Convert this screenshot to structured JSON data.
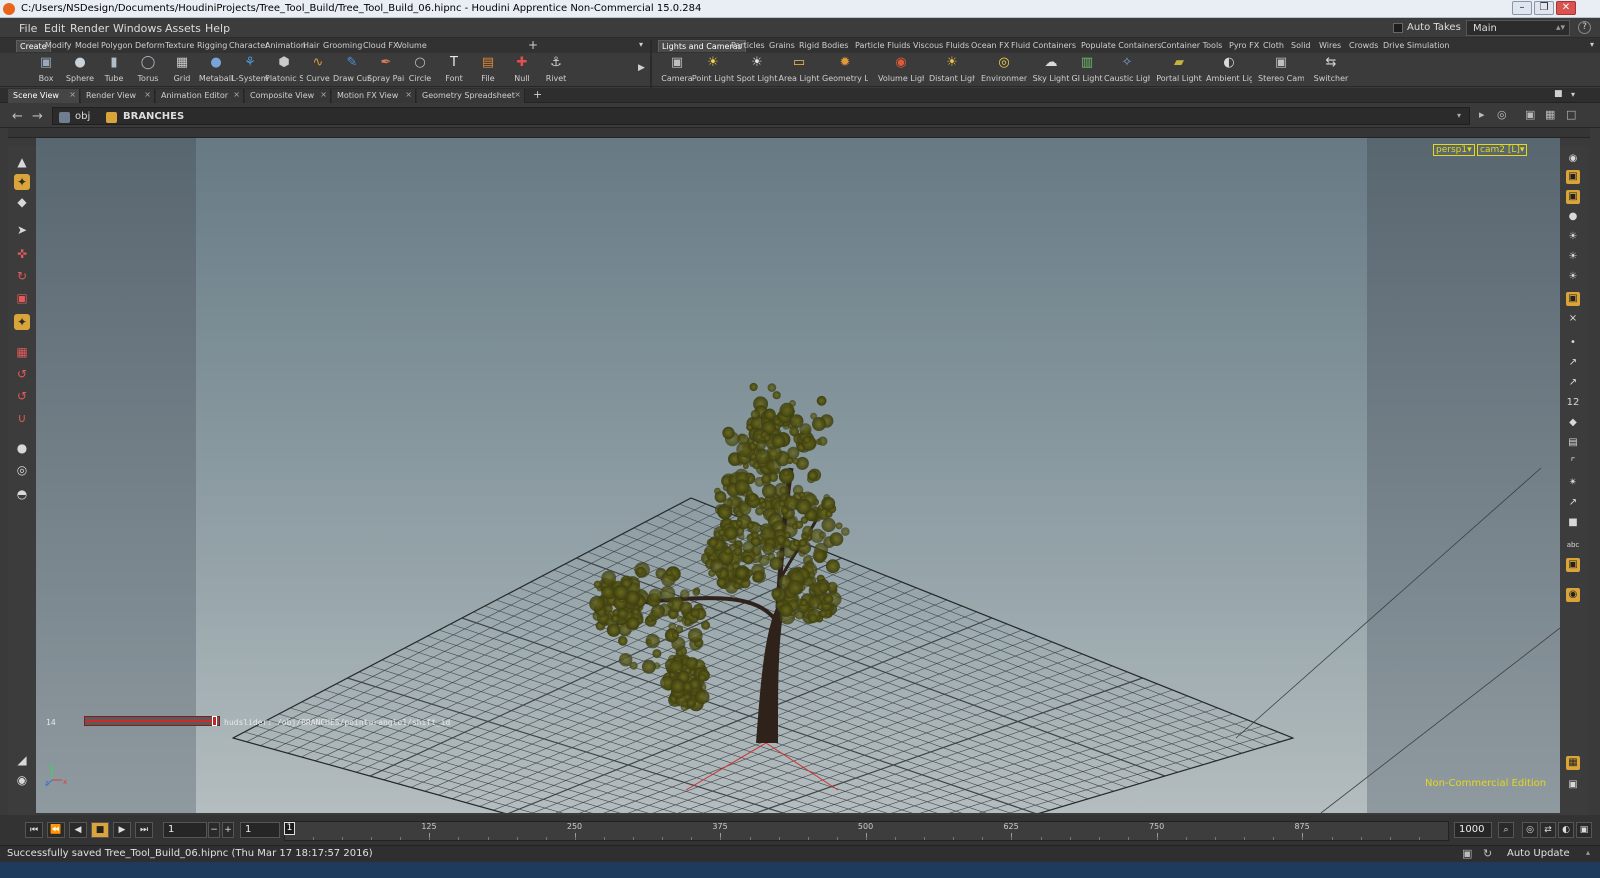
{
  "window": {
    "title": "C:/Users/NSDesign/Documents/HoudiniProjects/Tree_Tool_Build/Tree_Tool_Build_06.hipnc - Houdini Apprentice Non-Commercial 15.0.284",
    "controls": [
      "–",
      "❐",
      "✕"
    ]
  },
  "menu": {
    "items": [
      "File",
      "Edit",
      "Render",
      "Windows",
      "Assets",
      "Help"
    ],
    "auto_takes": "Auto Takes",
    "desktop": "Main",
    "help_icon": "?"
  },
  "shelf_left": {
    "tabs": [
      "Create",
      "Modify",
      "Model",
      "Polygon",
      "Deform",
      "Texture",
      "Rigging",
      "Character",
      "Animation",
      "Hair",
      "Grooming",
      "Cloud FX",
      "Volume"
    ],
    "active_tab": "Create",
    "tools": [
      {
        "label": "Box",
        "icon": "box-icon",
        "glyph": "▣"
      },
      {
        "label": "Sphere",
        "icon": "sphere-icon",
        "glyph": "●"
      },
      {
        "label": "Tube",
        "icon": "tube-icon",
        "glyph": "▮"
      },
      {
        "label": "Torus",
        "icon": "torus-icon",
        "glyph": "◯"
      },
      {
        "label": "Grid",
        "icon": "grid-icon",
        "glyph": "▦"
      },
      {
        "label": "Metaball",
        "icon": "metaball-icon",
        "glyph": "●"
      },
      {
        "label": "L-System",
        "icon": "lsystem-icon",
        "glyph": "⚘"
      },
      {
        "label": "Platonic Sol...",
        "icon": "platonic-icon",
        "glyph": "⬢"
      },
      {
        "label": "Curve",
        "icon": "curve-icon",
        "glyph": "∿"
      },
      {
        "label": "Draw Curve",
        "icon": "draw-curve-icon",
        "glyph": "✎"
      },
      {
        "label": "Spray Paint",
        "icon": "spray-paint-icon",
        "glyph": "✒"
      },
      {
        "label": "Circle",
        "icon": "circle-icon",
        "glyph": "○"
      },
      {
        "label": "Font",
        "icon": "font-icon",
        "glyph": "T"
      },
      {
        "label": "File",
        "icon": "file-icon",
        "glyph": "▤"
      },
      {
        "label": "Null",
        "icon": "null-icon",
        "glyph": "✚"
      },
      {
        "label": "Rivet",
        "icon": "rivet-icon",
        "glyph": "⚓"
      }
    ]
  },
  "shelf_right": {
    "tabs": [
      "Lights and Cameras",
      "Particles",
      "Grains",
      "Rigid Bodies",
      "Particle Fluids",
      "Viscous Fluids",
      "Ocean FX",
      "Fluid Containers",
      "Populate Containers",
      "Container Tools",
      "Pyro FX",
      "Cloth",
      "Solid",
      "Wires",
      "Crowds",
      "Drive Simulation"
    ],
    "active_tab": "Lights and Cameras",
    "tools": [
      {
        "label": "Camera",
        "icon": "camera-icon",
        "glyph": "▣"
      },
      {
        "label": "Point Light",
        "icon": "point-light-icon",
        "glyph": "☀"
      },
      {
        "label": "Spot Light",
        "icon": "spot-light-icon",
        "glyph": "☀"
      },
      {
        "label": "Area Light",
        "icon": "area-light-icon",
        "glyph": "▭"
      },
      {
        "label": "Geometry L...",
        "icon": "geometry-light-icon",
        "glyph": "✹"
      },
      {
        "label": "Volume Light",
        "icon": "volume-light-icon",
        "glyph": "◉"
      },
      {
        "label": "Distant Light",
        "icon": "distant-light-icon",
        "glyph": "☀"
      },
      {
        "label": "Environmen...",
        "icon": "environment-light-icon",
        "glyph": "◎"
      },
      {
        "label": "Sky Light",
        "icon": "sky-light-icon",
        "glyph": "☁"
      },
      {
        "label": "GI Light",
        "icon": "gi-light-icon",
        "glyph": "▥"
      },
      {
        "label": "Caustic Light",
        "icon": "caustic-light-icon",
        "glyph": "✧"
      },
      {
        "label": "Portal Light",
        "icon": "portal-light-icon",
        "glyph": "▰"
      },
      {
        "label": "Ambient Lig...",
        "icon": "ambient-light-icon",
        "glyph": "◐"
      },
      {
        "label": "Stereo Cam...",
        "icon": "stereo-camera-icon",
        "glyph": "▣"
      },
      {
        "label": "Switcher",
        "icon": "switcher-icon",
        "glyph": "⇆"
      }
    ]
  },
  "pane_tabs": [
    {
      "label": "Scene View",
      "active": true
    },
    {
      "label": "Render View",
      "active": false
    },
    {
      "label": "Animation Editor",
      "active": false
    },
    {
      "label": "Composite View",
      "active": false
    },
    {
      "label": "Motion FX View",
      "active": false
    },
    {
      "label": "Geometry Spreadsheet",
      "active": false
    }
  ],
  "path": {
    "root": "obj",
    "node": "BRANCHES"
  },
  "viewport": {
    "camera_menus": [
      "persp1▾",
      "cam2 [L]▾"
    ],
    "edition_label": "Non-Commercial Edition",
    "hud_value": "14",
    "hud_slider_fraction": 0.97,
    "hud_label": "hudslider: /obj/BRANCHES/pointwrangle1/shift_id",
    "axis_labels": {
      "y": "y",
      "z": "z",
      "x": "x"
    },
    "colors": {
      "hud": "#e6d71a",
      "accent": "#d9a53a",
      "tree_foliage": "#4f5014",
      "trunk": "#2e221b"
    }
  },
  "timeline": {
    "start_frame": "1",
    "current_field": "1",
    "current_frame": "1",
    "end_frame": "1000",
    "ticks": [
      "125",
      "250",
      "375",
      "500",
      "625",
      "750",
      "875"
    ],
    "auto_update": "Auto Update"
  },
  "status": {
    "message": "Successfully saved Tree_Tool_Build_06.hipnc (Thu Mar 17 18:17:57 2016)"
  }
}
